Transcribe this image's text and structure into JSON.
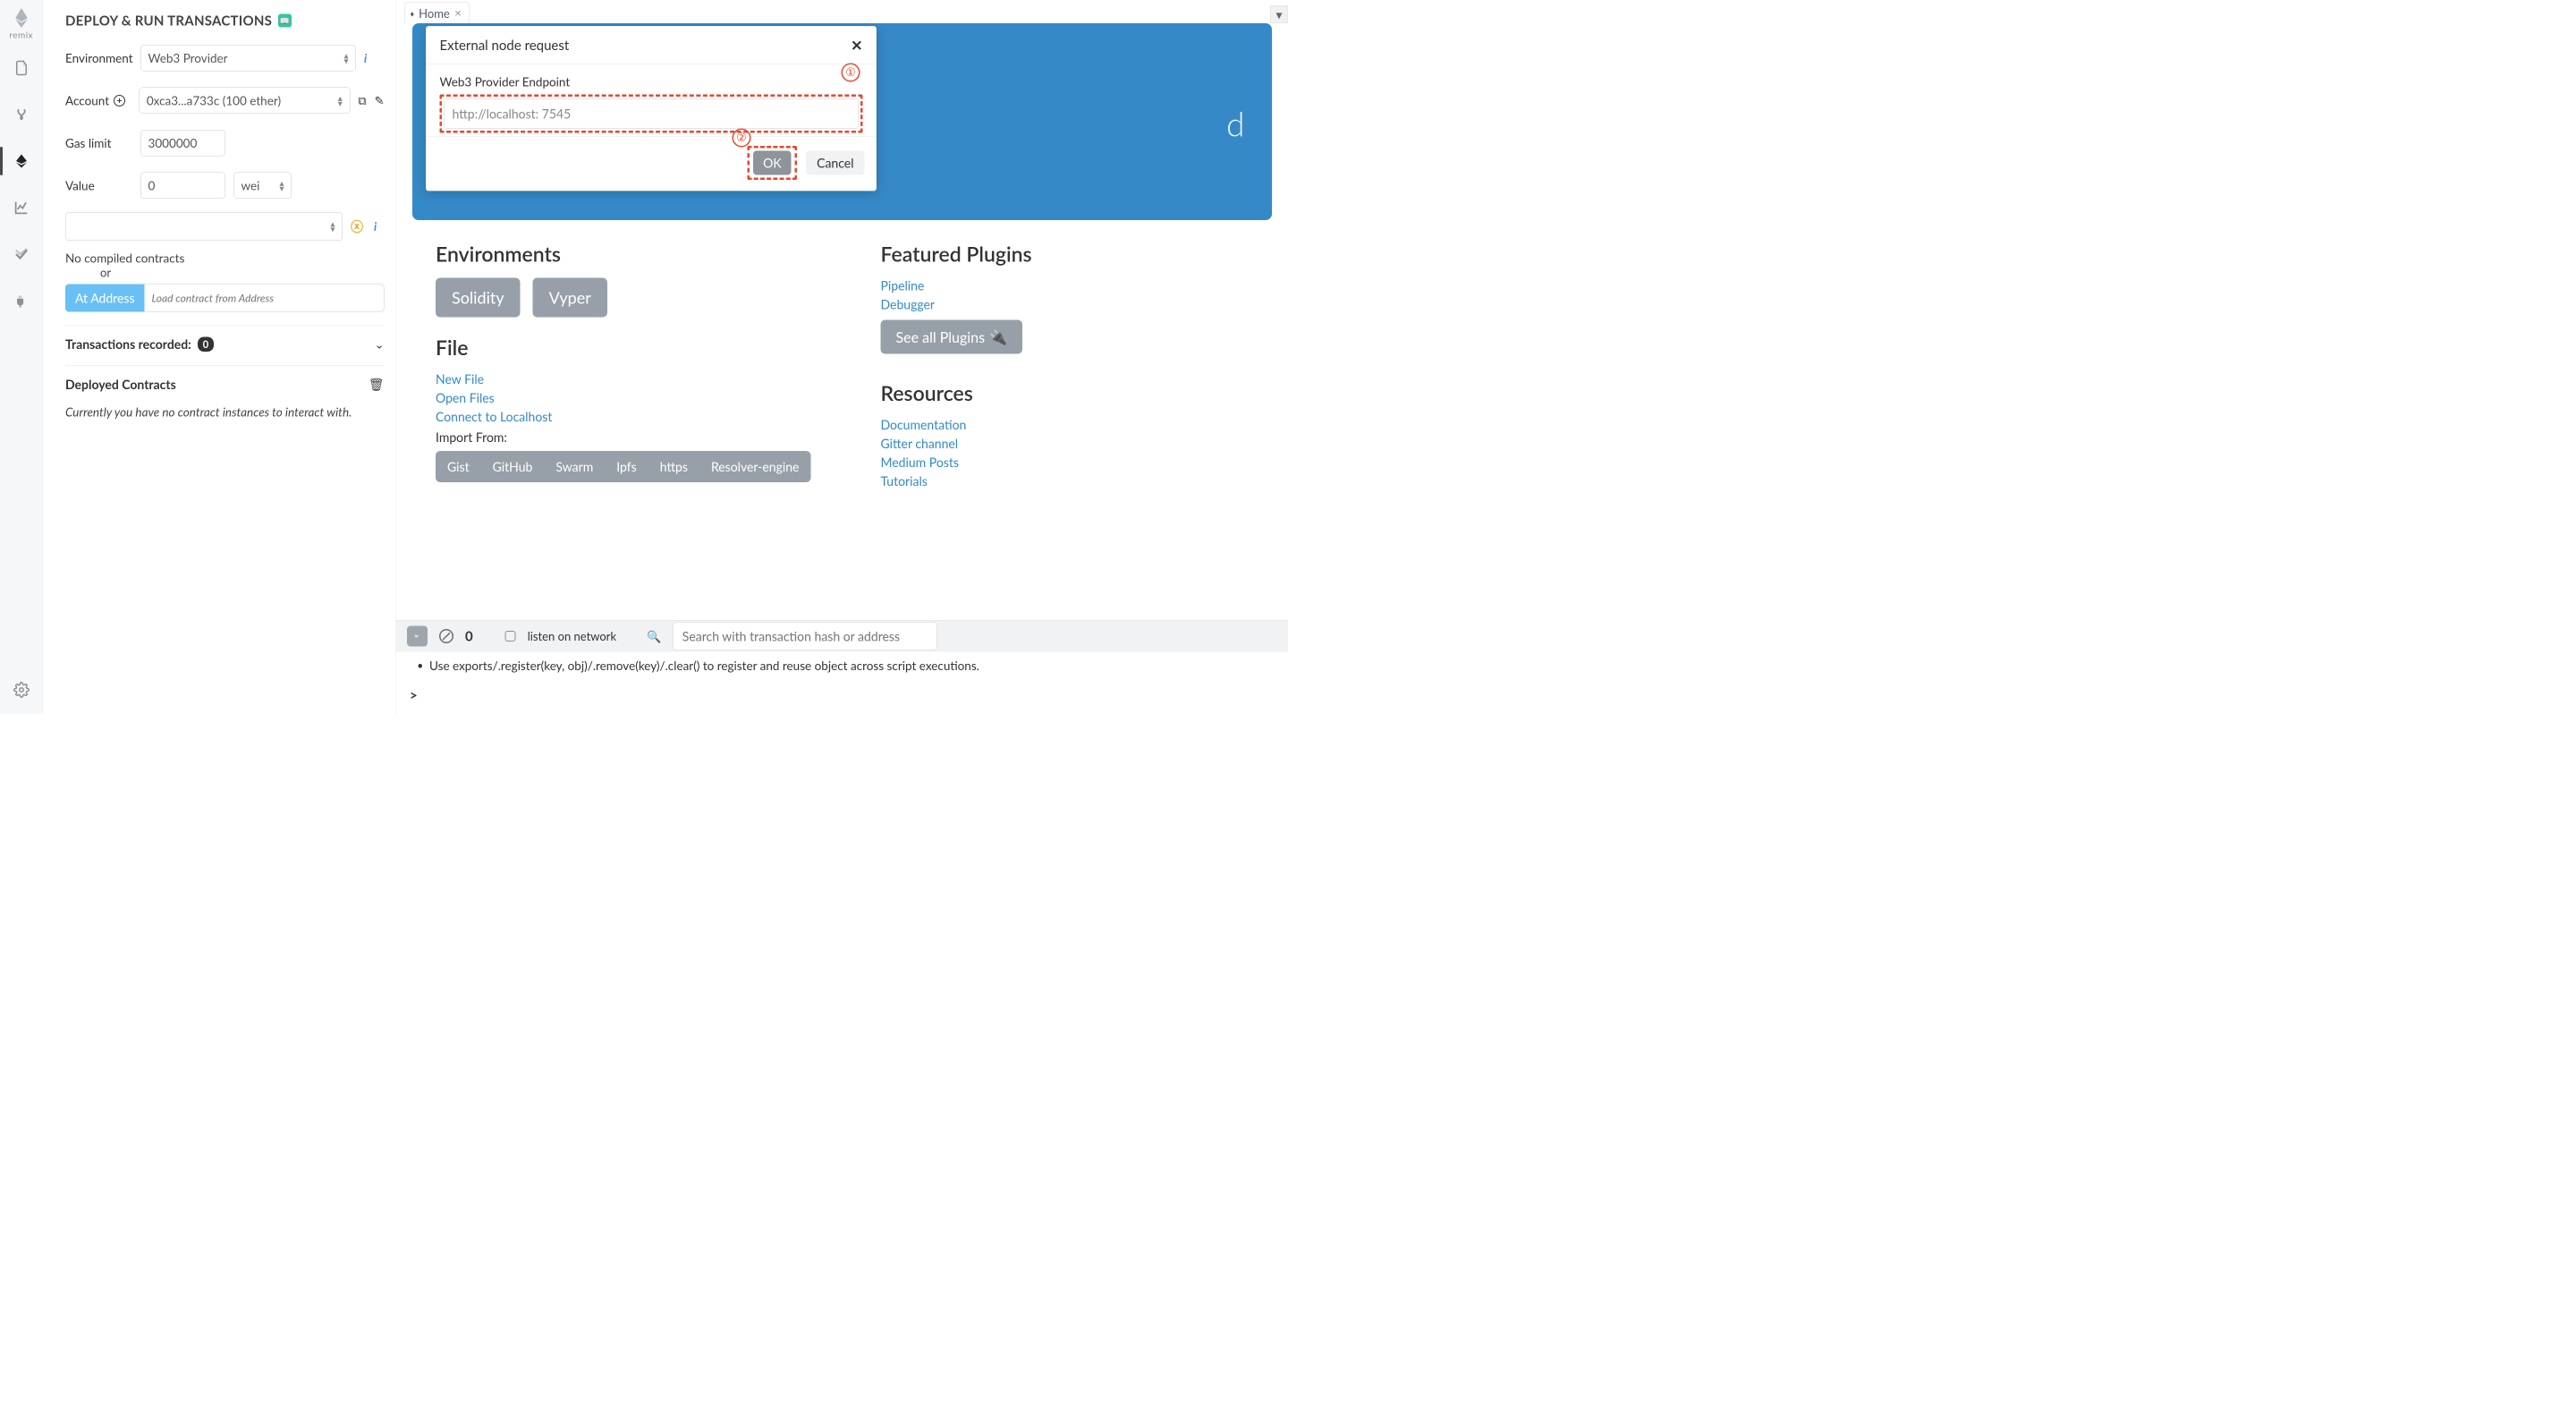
{
  "brand": "remix",
  "panel": {
    "title": "DEPLOY & RUN TRANSACTIONS",
    "environment_label": "Environment",
    "environment_value": "Web3 Provider",
    "account_label": "Account",
    "account_value": "0xca3...a733c (100 ether)",
    "gaslimit_label": "Gas limit",
    "gaslimit_value": "3000000",
    "value_label": "Value",
    "value_value": "0",
    "value_unit": "wei",
    "no_compiled": "No compiled contracts",
    "or": "or",
    "ataddress_btn": "At Address",
    "ataddress_placeholder": "Load contract from Address",
    "tx_recorded_label": "Transactions recorded:",
    "tx_recorded_count": "0",
    "deployed_title": "Deployed Contracts",
    "deployed_empty": "Currently you have no contract instances to interact with."
  },
  "tab": {
    "name": "Home"
  },
  "hero": {
    "playtext": "d"
  },
  "home": {
    "env_title": "Environments",
    "env_buttons": [
      "Solidity",
      "Vyper"
    ],
    "file_title": "File",
    "file_links": [
      "New File",
      "Open Files",
      "Connect to Localhost"
    ],
    "import_label": "Import From:",
    "import_buttons": [
      "Gist",
      "GitHub",
      "Swarm",
      "Ipfs",
      "https",
      "Resolver-engine"
    ],
    "plugins_title": "Featured Plugins",
    "plugin_links": [
      "Pipeline",
      "Debugger"
    ],
    "see_all": "See all Plugins",
    "resources_title": "Resources",
    "resource_links": [
      "Documentation",
      "Gitter channel",
      "Medium Posts",
      "Tutorials"
    ]
  },
  "terminal": {
    "count": "0",
    "listen": "listen on network",
    "search_placeholder": "Search with transaction hash or address",
    "line": "Use exports/.register(key, obj)/.remove(key)/.clear() to register and reuse object across script executions.",
    "prompt": ">"
  },
  "modal": {
    "title": "External node request",
    "endpoint_label": "Web3 Provider Endpoint",
    "endpoint_value": "http://localhost: 7545",
    "ok": "OK",
    "cancel": "Cancel",
    "marker1": "①",
    "marker2": "②"
  }
}
